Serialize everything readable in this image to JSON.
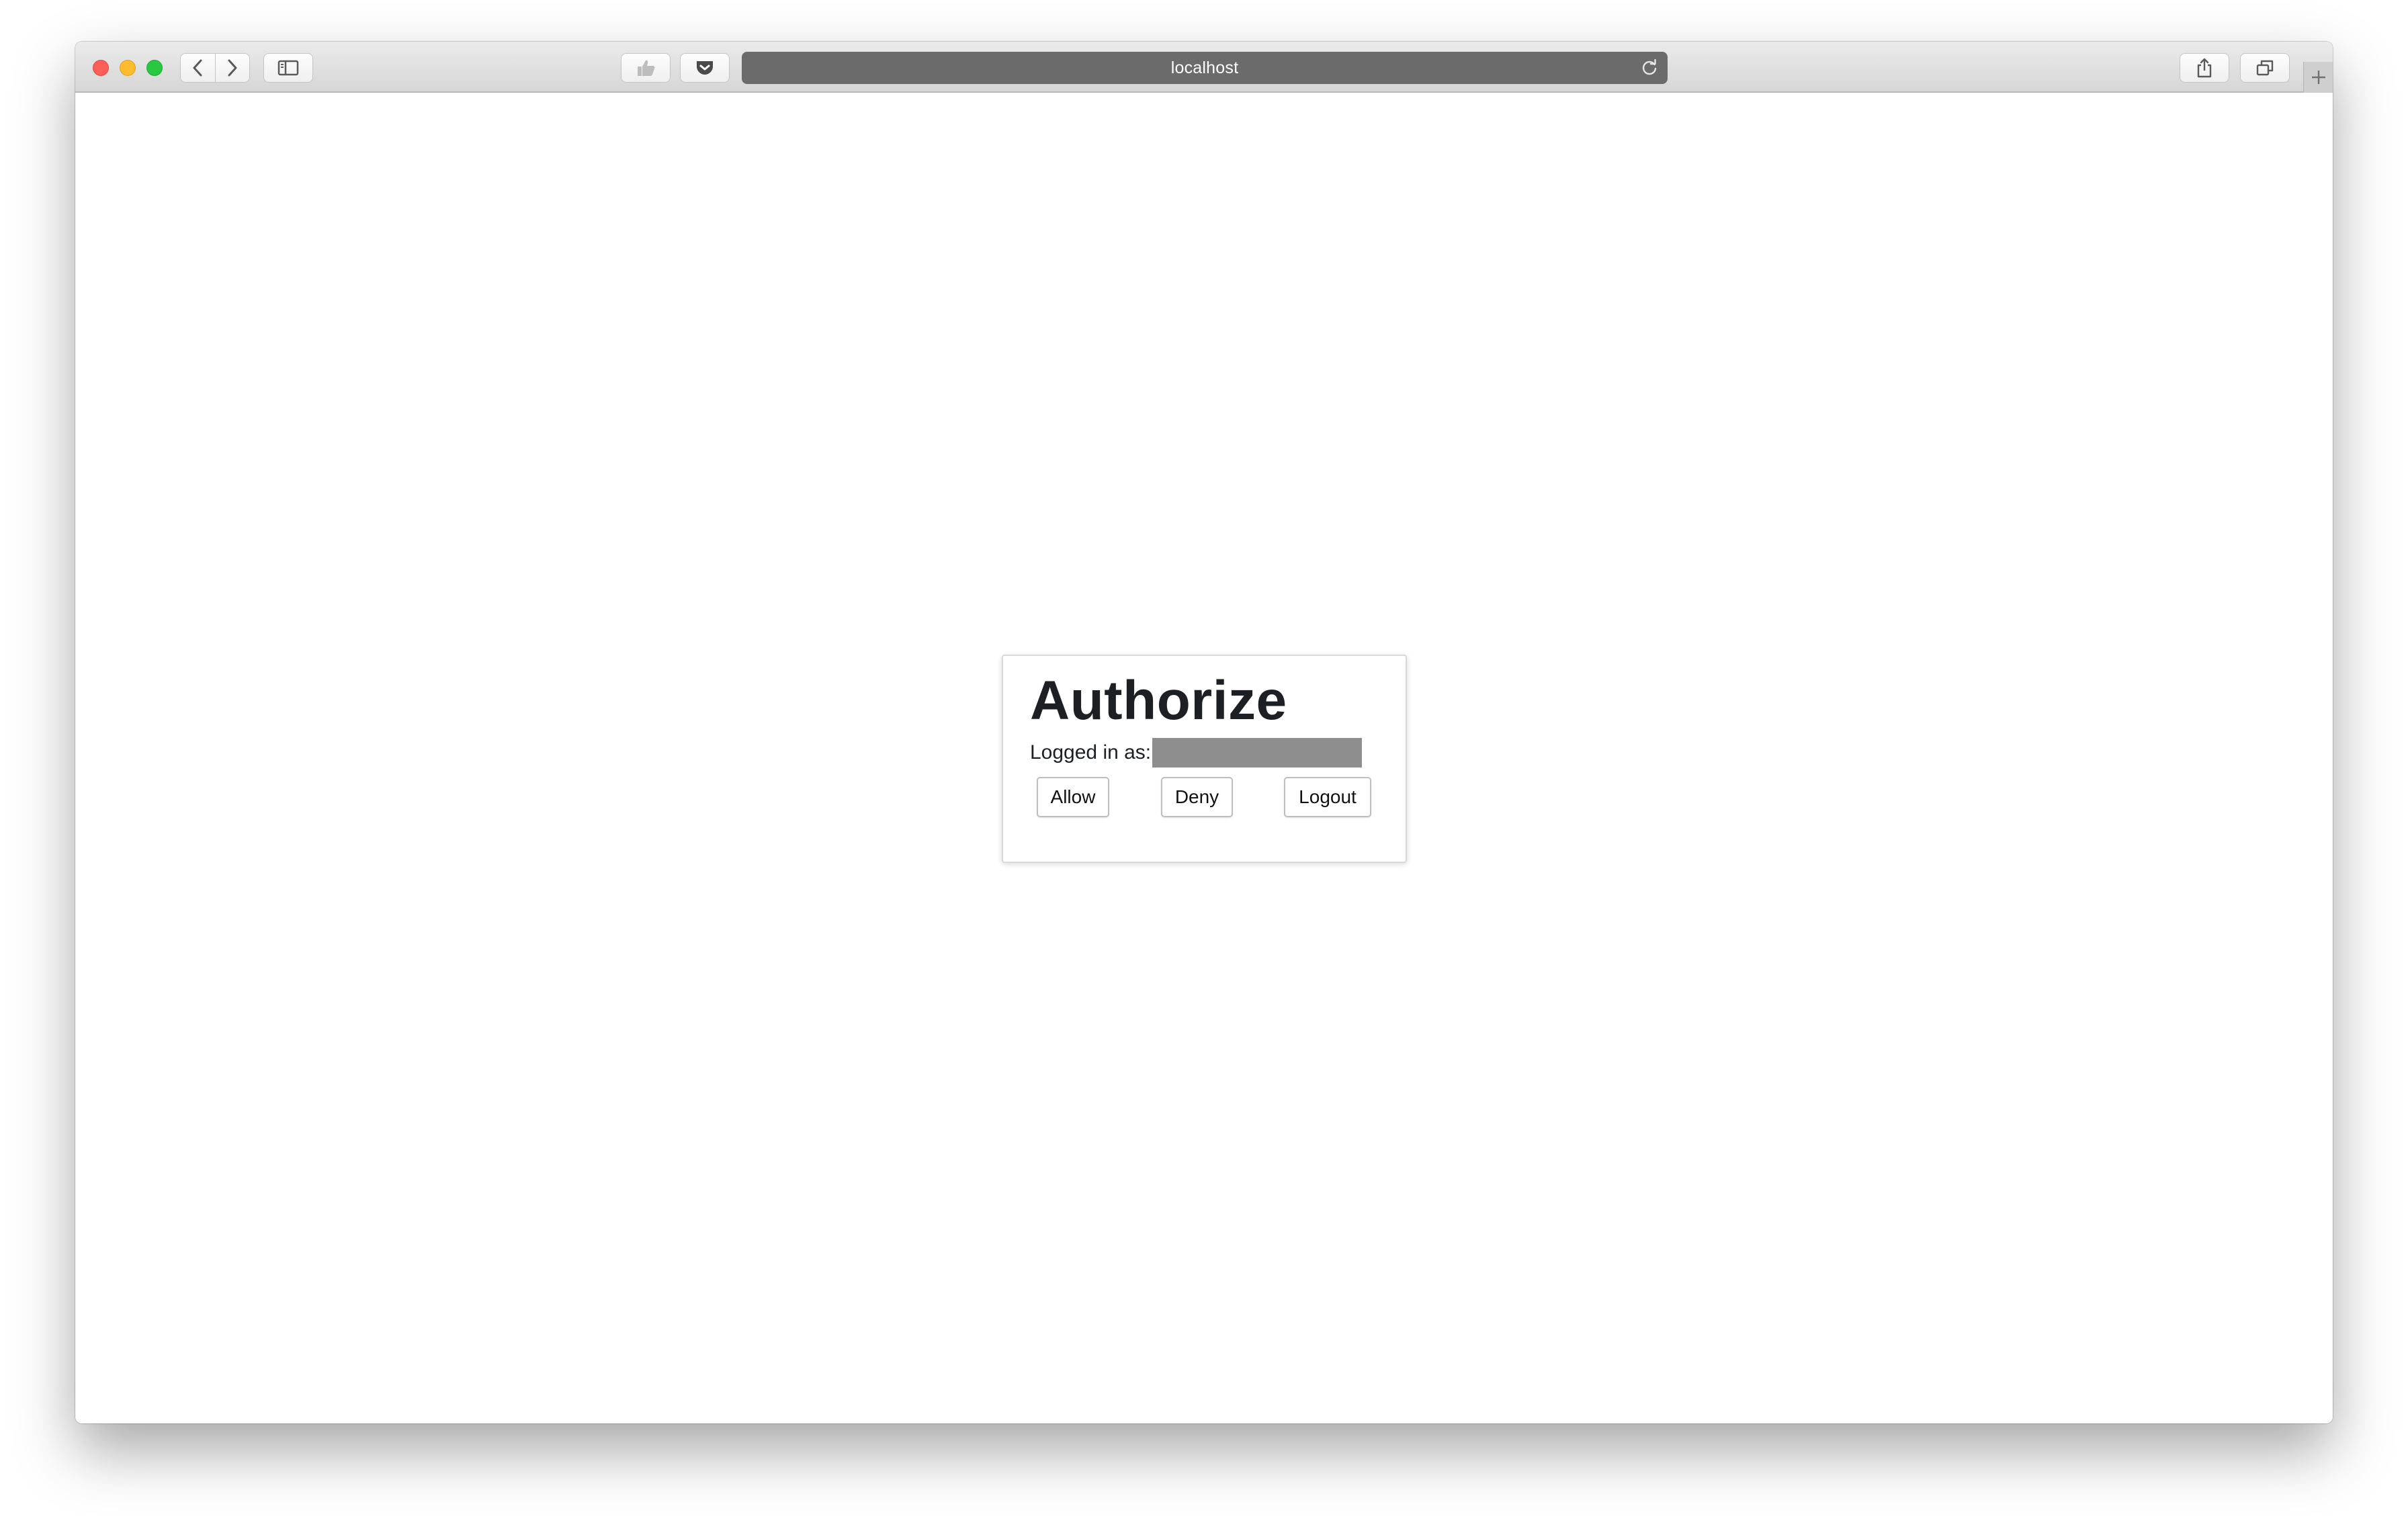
{
  "browser": {
    "address": "localhost",
    "colors": {
      "close": "#fc5f57",
      "minimize": "#fdbc2e",
      "zoom": "#28c840",
      "address_bar": "#6b6b6b"
    },
    "icons": {
      "back": "chevron-left-icon",
      "forward": "chevron-right-icon",
      "sidebar": "sidebar-icon",
      "extension": "thumbs-up-icon",
      "pocket": "pocket-icon",
      "reload": "reload-icon",
      "share": "share-icon",
      "tabs": "tabs-overview-icon",
      "new_tab": "plus-icon"
    }
  },
  "auth": {
    "title": "Authorize",
    "logged_in_label": "Logged in as:",
    "buttons": {
      "allow": "Allow",
      "deny": "Deny",
      "logout": "Logout"
    }
  }
}
